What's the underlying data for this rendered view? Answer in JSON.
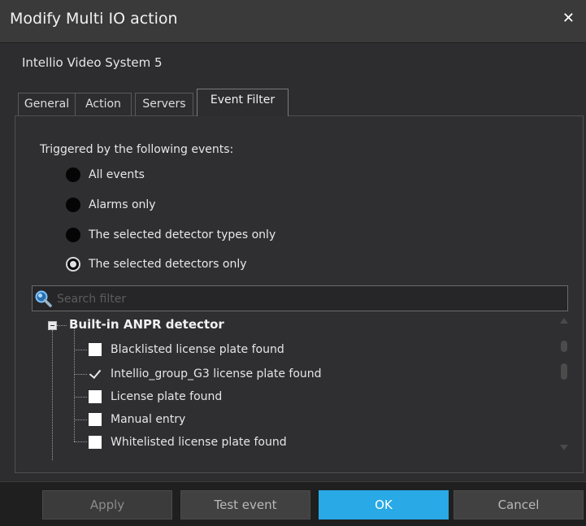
{
  "window": {
    "title": "Modify Multi IO action",
    "close_glyph": "✕",
    "subtitle": "Intellio Video System 5"
  },
  "tabs": [
    {
      "label": "General"
    },
    {
      "label": "Action"
    },
    {
      "label": "Servers"
    },
    {
      "label": "Event Filter",
      "active": true
    }
  ],
  "event_filter": {
    "group_label": "Triggered by the following events:",
    "options": [
      {
        "label": "All events",
        "selected": false
      },
      {
        "label": "Alarms only",
        "selected": false
      },
      {
        "label": "The selected detector types only",
        "selected": false
      },
      {
        "label": "The selected detectors only",
        "selected": true
      }
    ],
    "search": {
      "placeholder": "Search filter",
      "value": "",
      "icon": "search-icon"
    },
    "tree": {
      "group": "Built-in ANPR detector",
      "items": [
        {
          "label": "Blacklisted license plate found",
          "checked": false
        },
        {
          "label": "Intellio_group_G3 license plate found",
          "checked": true
        },
        {
          "label": "License plate found",
          "checked": false
        },
        {
          "label": "Manual entry",
          "checked": false
        },
        {
          "label": "Whitelisted license plate found",
          "checked": false
        }
      ]
    }
  },
  "buttons": {
    "apply": "Apply",
    "test_event": "Test event",
    "ok": "OK",
    "cancel": "Cancel"
  },
  "colors": {
    "accent": "#29a9e6",
    "window_bg": "#2d2d30",
    "titlebar_bg": "#3a3a3a"
  }
}
